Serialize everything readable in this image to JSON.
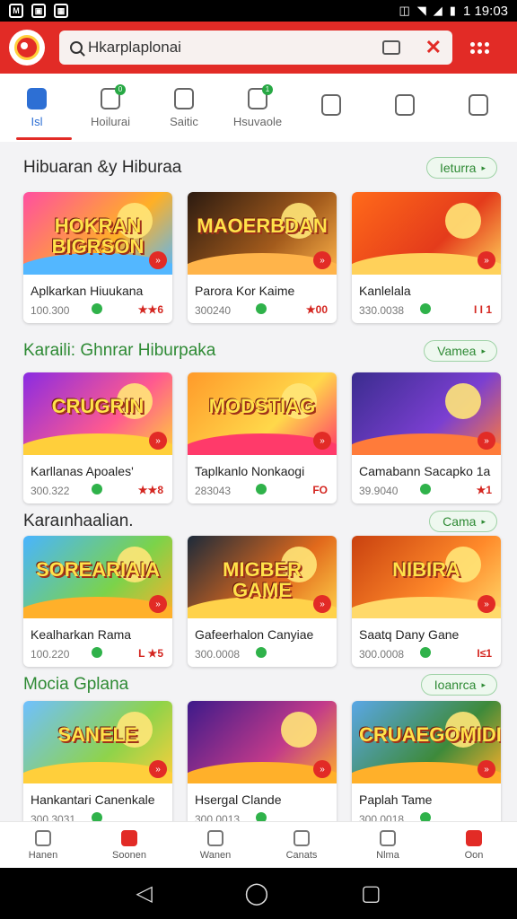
{
  "status_bar": {
    "time": "1 19:03",
    "left_icons": [
      "notification-icon",
      "photo-icon",
      "image-icon"
    ]
  },
  "app_bar": {
    "search_text": "Hkarplaplonai"
  },
  "tabs": [
    {
      "label": "Isl",
      "icon": "home-icon",
      "active": true
    },
    {
      "label": "Hoilurai",
      "icon": "puzzle-icon",
      "badge": "0"
    },
    {
      "label": "Saitic",
      "icon": "house-icon"
    },
    {
      "label": "Hsuvaole",
      "icon": "game-controller-icon",
      "badge": "1"
    },
    {
      "label": "",
      "icon": "bell-icon"
    },
    {
      "label": "",
      "icon": "search-icon"
    },
    {
      "label": "",
      "icon": "tablet-icon"
    }
  ],
  "sections": [
    {
      "title": "Hibuaran &y Hiburaa",
      "title_color": "dark",
      "more_label": "Ieturra",
      "cards": [
        {
          "thumb_text": "HOKRAN BIGRSON",
          "name": "Aplkarkan Hiuukana",
          "count": "100.300",
          "rating": "★★6",
          "c1": "#ff4fa0",
          "c2": "#ffb026",
          "c3": "#53b7ff"
        },
        {
          "thumb_text": "MAOERBDAN",
          "name": "Parora Kor Kaime",
          "count": "300240",
          "rating": "★00",
          "c1": "#2b1a10",
          "c2": "#a35b1c",
          "c3": "#ffb44a"
        },
        {
          "thumb_text": "",
          "name": "Kanlelala",
          "count": "330.0038",
          "rating": "I I 1",
          "c1": "#ff6a1a",
          "c2": "#e43b1b",
          "c3": "#ffd15a"
        }
      ]
    },
    {
      "title": "Karaili: Ghnrar Hiburpaka",
      "title_color": "green",
      "more_label": "Vamea",
      "cards": [
        {
          "thumb_text": "CRUGRIN",
          "name": "Karllanas Apoales'",
          "count": "300.322",
          "rating": "★★8",
          "c1": "#8a2be2",
          "c2": "#ff5a8f",
          "c3": "#ffcf3b"
        },
        {
          "thumb_text": "MODSTIAG",
          "name": "Taplkanlo Nonkaogi",
          "count": "283043",
          "rating": "FO",
          "c1": "#ff9a2a",
          "c2": "#ffd84a",
          "c3": "#ff3a6a"
        },
        {
          "thumb_text": "",
          "name": "Camabann Sacapko 1a",
          "count": "39.9040",
          "rating": "★1",
          "c1": "#3a2c8e",
          "c2": "#7b3fd1",
          "c3": "#ff7b3a"
        }
      ]
    },
    {
      "title": "Karaınhaalian.",
      "title_color": "dark",
      "more_label": "Cama",
      "cards": [
        {
          "thumb_text": "SOREARIAIA",
          "name": "Kealharkan Rama",
          "count": "100.220",
          "rating": "L ★5",
          "c1": "#49b4ff",
          "c2": "#7bd34a",
          "c3": "#ffb02a"
        },
        {
          "thumb_text": "MIGBER GAME",
          "name": "Gafeerhalon Canyiae",
          "count": "300.0008",
          "rating": "",
          "c1": "#1c2a3a",
          "c2": "#e26a1c",
          "c3": "#ffd24a"
        },
        {
          "thumb_text": "NIBIRA",
          "name": "Saatq Dany Gane",
          "count": "300.0008",
          "rating": "I≤1",
          "c1": "#c9410f",
          "c2": "#ff8a2a",
          "c3": "#ffd96a"
        }
      ]
    },
    {
      "title": "Mocia Gplana",
      "title_color": "green",
      "more_label": "Ioanrca",
      "cards": [
        {
          "thumb_text": "SANELE",
          "name": "Hankantari Canenkale",
          "count": "300.3031",
          "rating": "",
          "c1": "#6fc0ff",
          "c2": "#8fd34a",
          "c3": "#ffcf3b"
        },
        {
          "thumb_text": "",
          "name": "Hsergal Clande",
          "count": "300.0013",
          "rating": "",
          "c1": "#3d1a8a",
          "c2": "#c23a8a",
          "c3": "#ffb02a"
        },
        {
          "thumb_text": "CRUAEGOMIDIAS",
          "name": "Paplah Tame",
          "count": "300.0018",
          "rating": "",
          "c1": "#5aa7e6",
          "c2": "#3e8a3a",
          "c3": "#ffb02a"
        }
      ]
    }
  ],
  "bottom_nav": [
    {
      "label": "Hanen",
      "icon": "document-icon",
      "red": false
    },
    {
      "label": "Soonen",
      "icon": "shop-icon",
      "red": true
    },
    {
      "label": "Wanen",
      "icon": "gift-icon",
      "red": false
    },
    {
      "label": "Canats",
      "icon": "folder-icon",
      "red": false
    },
    {
      "label": "Nlma",
      "icon": "link-icon",
      "red": false
    },
    {
      "label": "Oon",
      "icon": "mail-icon",
      "red": true
    }
  ],
  "system_nav": {
    "back": "◁",
    "home": "◯",
    "recents": "▢"
  }
}
